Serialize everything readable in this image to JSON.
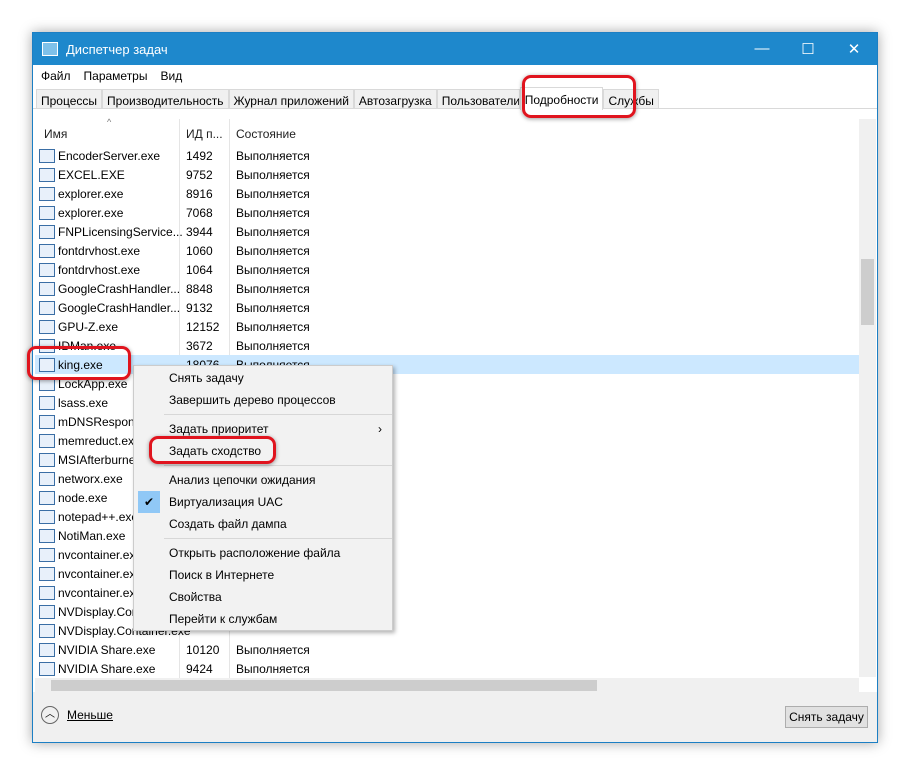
{
  "window": {
    "title": "Диспетчер задач",
    "controls": [
      "—",
      "☐",
      "✕"
    ]
  },
  "menu": [
    "Файл",
    "Параметры",
    "Вид"
  ],
  "tabs": [
    {
      "label": "Процессы"
    },
    {
      "label": "Производительность"
    },
    {
      "label": "Журнал приложений"
    },
    {
      "label": "Автозагрузка"
    },
    {
      "label": "Пользователи"
    },
    {
      "label": "Подробности",
      "active": true
    },
    {
      "label": "Службы"
    }
  ],
  "columns": {
    "name": "Имя",
    "pid": "ИД п...",
    "status": "Состояние"
  },
  "rows": [
    {
      "name": "EncoderServer.exe",
      "pid": "1492",
      "status": "Выполняется"
    },
    {
      "name": "EXCEL.EXE",
      "pid": "9752",
      "status": "Выполняется"
    },
    {
      "name": "explorer.exe",
      "pid": "8916",
      "status": "Выполняется"
    },
    {
      "name": "explorer.exe",
      "pid": "7068",
      "status": "Выполняется"
    },
    {
      "name": "FNPLicensingService...",
      "pid": "3944",
      "status": "Выполняется"
    },
    {
      "name": "fontdrvhost.exe",
      "pid": "1060",
      "status": "Выполняется"
    },
    {
      "name": "fontdrvhost.exe",
      "pid": "1064",
      "status": "Выполняется"
    },
    {
      "name": "GoogleCrashHandler...",
      "pid": "8848",
      "status": "Выполняется"
    },
    {
      "name": "GoogleCrashHandler...",
      "pid": "9132",
      "status": "Выполняется"
    },
    {
      "name": "GPU-Z.exe",
      "pid": "12152",
      "status": "Выполняется"
    },
    {
      "name": "IDMan.exe",
      "pid": "3672",
      "status": "Выполняется"
    },
    {
      "name": "king.exe",
      "pid": "18076",
      "status": "Выполняется",
      "selected": true
    },
    {
      "name": "LockApp.exe",
      "pid": "",
      "status": ""
    },
    {
      "name": "lsass.exe",
      "pid": "",
      "status": ""
    },
    {
      "name": "mDNSResponder.exe",
      "pid": "",
      "status": ""
    },
    {
      "name": "memreduct.exe",
      "pid": "",
      "status": ""
    },
    {
      "name": "MSIAfterburner.exe",
      "pid": "",
      "status": ""
    },
    {
      "name": "networx.exe",
      "pid": "",
      "status": ""
    },
    {
      "name": "node.exe",
      "pid": "",
      "status": ""
    },
    {
      "name": "notepad++.exe",
      "pid": "",
      "status": ""
    },
    {
      "name": "NotiMan.exe",
      "pid": "",
      "status": ""
    },
    {
      "name": "nvcontainer.exe",
      "pid": "",
      "status": ""
    },
    {
      "name": "nvcontainer.exe",
      "pid": "",
      "status": ""
    },
    {
      "name": "nvcontainer.exe",
      "pid": "",
      "status": ""
    },
    {
      "name": "NVDisplay.Container.exe",
      "pid": "",
      "status": ""
    },
    {
      "name": "NVDisplay.Container.exe",
      "pid": "",
      "status": ""
    },
    {
      "name": "NVIDIA Share.exe",
      "pid": "10120",
      "status": "Выполняется"
    },
    {
      "name": "NVIDIA Share.exe",
      "pid": "9424",
      "status": "Выполняется"
    }
  ],
  "context_menu": [
    {
      "label": "Снять задачу"
    },
    {
      "label": "Завершить дерево процессов"
    },
    {
      "sep": true
    },
    {
      "label": "Задать приоритет",
      "submenu": true
    },
    {
      "label": "Задать сходство",
      "highlighted": true
    },
    {
      "sep": true
    },
    {
      "label": "Анализ цепочки ожидания"
    },
    {
      "label": "Виртуализация UAC",
      "checked": true
    },
    {
      "label": "Создать файл дампа"
    },
    {
      "sep": true
    },
    {
      "label": "Открыть расположение файла"
    },
    {
      "label": "Поиск в Интернете"
    },
    {
      "label": "Свойства"
    },
    {
      "label": "Перейти к службам"
    }
  ],
  "footer": {
    "less": "Меньше",
    "end_task": "Снять задачу"
  },
  "colors": {
    "titlebar": "#1e88cc",
    "selection": "#cce8ff",
    "highlight": "#e0141e"
  }
}
